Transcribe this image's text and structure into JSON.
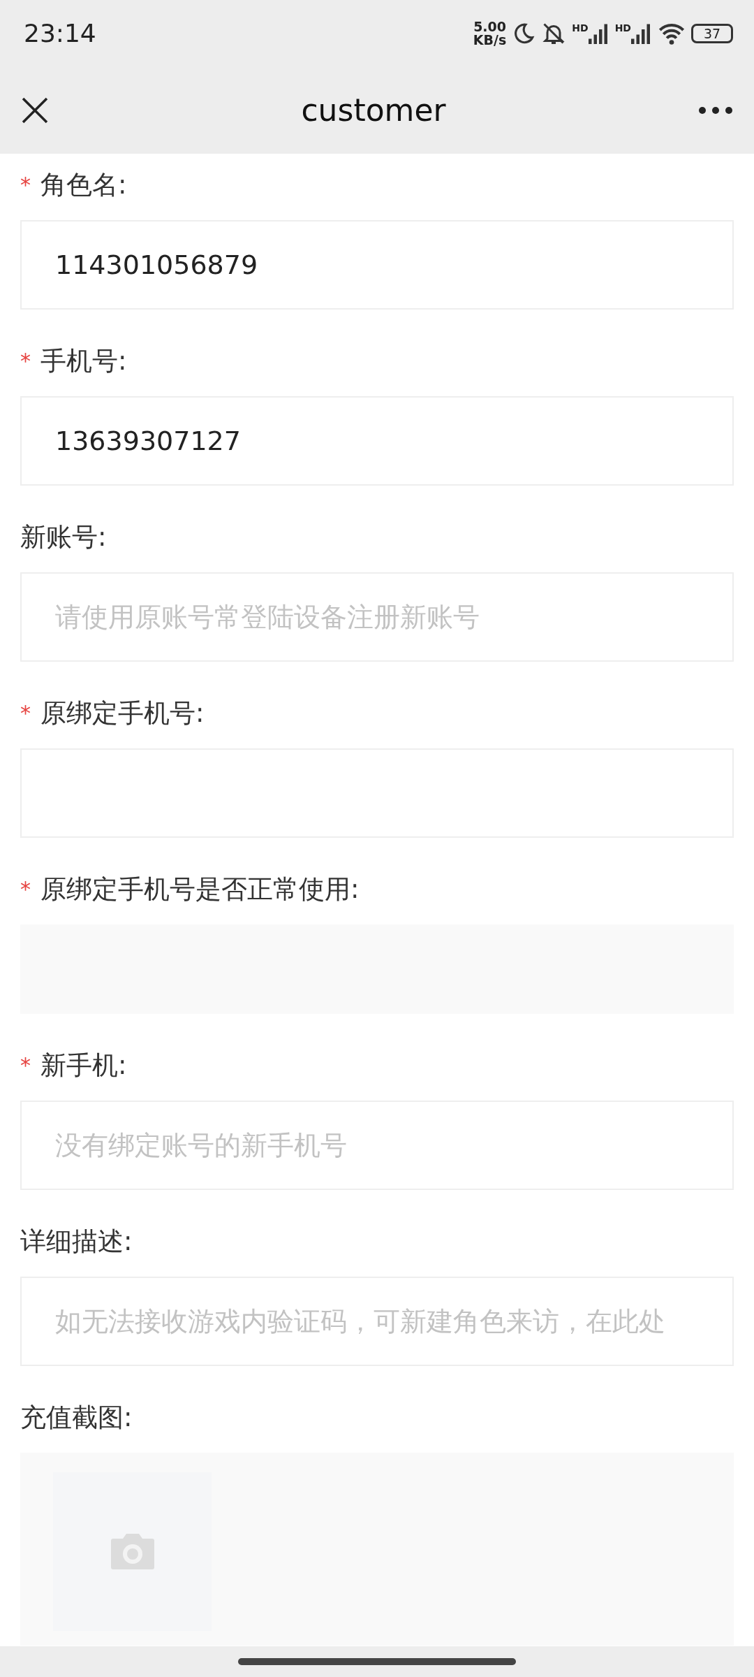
{
  "status_bar": {
    "time": "23:14",
    "speed_value": "5.00",
    "speed_unit": "KB/s",
    "signals": [
      {
        "label": "HD"
      },
      {
        "label": "HD"
      }
    ],
    "battery": "37"
  },
  "header": {
    "title": "customer"
  },
  "fields": [
    {
      "kind": "input",
      "asterisk": "*",
      "label": "角色名:",
      "value": "114301056879"
    },
    {
      "kind": "input",
      "asterisk": "*",
      "label": "手机号:",
      "value": "13639307127"
    },
    {
      "kind": "input",
      "label": "新账号:",
      "placeholder": "请使用原账号常登陆设备注册新账号"
    },
    {
      "kind": "input",
      "asterisk": "*",
      "label": "原绑定手机号:"
    },
    {
      "kind": "select",
      "asterisk": "*",
      "label": "原绑定手机号是否正常使用:"
    },
    {
      "kind": "input",
      "asterisk": "*",
      "label": "新手机:",
      "placeholder": "没有绑定账号的新手机号"
    },
    {
      "kind": "input",
      "label": "详细描述:",
      "placeholder": "如无法接收游戏内验证码，可新建角色来访，在此处"
    },
    {
      "kind": "upload",
      "label": "充值截图:"
    }
  ]
}
